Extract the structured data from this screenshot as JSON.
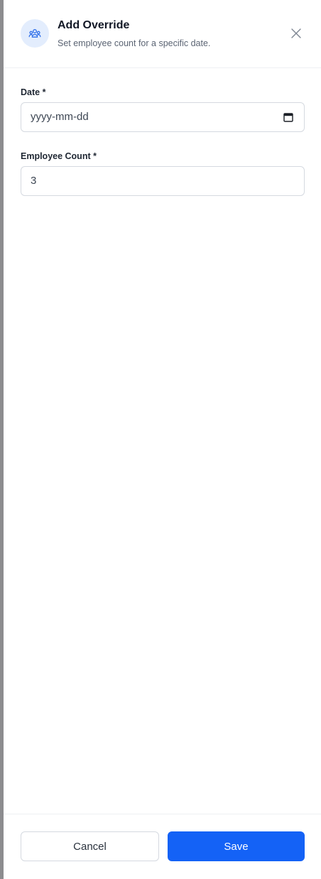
{
  "header": {
    "title": "Add Override",
    "subtitle": "Set employee count for a specific date.",
    "icon": "users-icon",
    "close_icon": "close-icon"
  },
  "form": {
    "date": {
      "label": "Date *",
      "placeholder": "yyyy-mm-dd",
      "icon": "calendar-icon"
    },
    "employee_count": {
      "label": "Employee Count *",
      "value": "3"
    }
  },
  "footer": {
    "cancel_label": "Cancel",
    "save_label": "Save"
  },
  "colors": {
    "accent": "#1462f6",
    "icon_bg": "#e3edfd"
  }
}
